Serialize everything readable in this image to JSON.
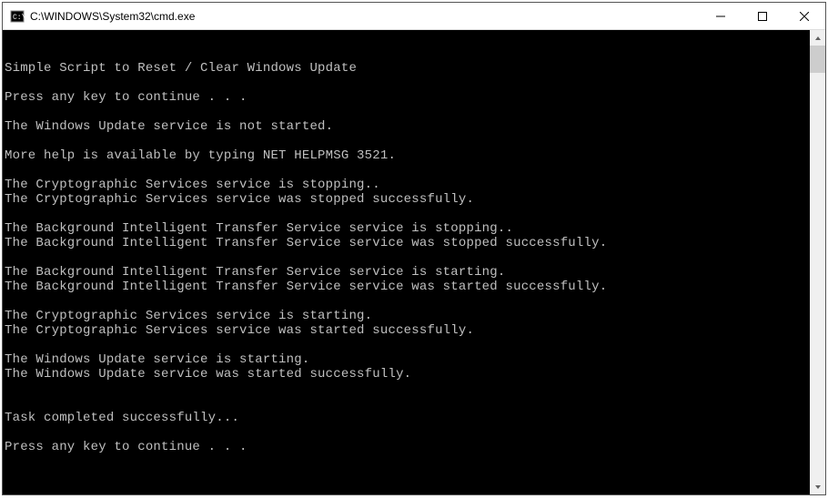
{
  "window": {
    "title": "C:\\WINDOWS\\System32\\cmd.exe"
  },
  "console": {
    "lines": [
      "Simple Script to Reset / Clear Windows Update",
      "",
      "Press any key to continue . . .",
      "",
      "The Windows Update service is not started.",
      "",
      "More help is available by typing NET HELPMSG 3521.",
      "",
      "The Cryptographic Services service is stopping..",
      "The Cryptographic Services service was stopped successfully.",
      "",
      "The Background Intelligent Transfer Service service is stopping..",
      "The Background Intelligent Transfer Service service was stopped successfully.",
      "",
      "The Background Intelligent Transfer Service service is starting.",
      "The Background Intelligent Transfer Service service was started successfully.",
      "",
      "The Cryptographic Services service is starting.",
      "The Cryptographic Services service was started successfully.",
      "",
      "The Windows Update service is starting.",
      "The Windows Update service was started successfully.",
      "",
      "",
      "Task completed successfully...",
      "",
      "Press any key to continue . . ."
    ]
  }
}
